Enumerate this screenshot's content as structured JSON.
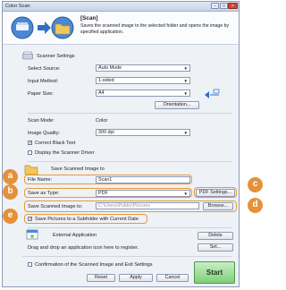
{
  "window": {
    "title": "Color Scan",
    "minimize_glyph": "−",
    "maximize_glyph": "□",
    "close_glyph": "×"
  },
  "header": {
    "title": "[Scan]",
    "description": "Saves the scanned image to the selected folder and opens the image by specified application."
  },
  "scanner_settings": {
    "heading": "Scanner Settings",
    "select_source": {
      "label": "Select Source:",
      "value": "Auto Mode"
    },
    "input_method": {
      "label": "Input Method:",
      "value": "1-sided"
    },
    "paper_size": {
      "label": "Paper Size:",
      "value": "A4"
    },
    "orientation_button": "Orientation...",
    "scan_mode": {
      "label": "Scan Mode:",
      "value": "Color"
    },
    "image_quality": {
      "label": "Image Quality:",
      "value": "300 dpi"
    },
    "correct_black_text": {
      "label": "Correct Black Text",
      "checked": true
    },
    "display_scanner_driver": {
      "label": "Display the Scanner Driver",
      "checked": false
    }
  },
  "save_settings": {
    "heading": "Save Scanned Image to",
    "file_name": {
      "label": "File Name:",
      "value": "Scan1"
    },
    "save_as_type": {
      "label": "Save as Type:",
      "value": "PDF"
    },
    "pdf_settings_button": "PDF Settings...",
    "save_to": {
      "label": "Save Scanned Image to:",
      "value": "C:\\Users\\Public\\Pictures"
    },
    "browse_button": "Browse...",
    "subfolder": {
      "label": "Save Pictures to a Subfolder with Current Date",
      "checked": true
    }
  },
  "external_application": {
    "heading": "External Application",
    "hint": "Drag and drop an application icon here to register.",
    "delete_button": "Delete",
    "set_button": "Set..."
  },
  "footer": {
    "confirmation": {
      "label": "Confirmation of the Scanned Image and Exit Settings",
      "checked": false
    },
    "reset_button": "Reset",
    "apply_button": "Apply",
    "cancel_button": "Cancel",
    "start_button": "Start"
  },
  "callouts": {
    "a": "a",
    "b": "b",
    "c": "c",
    "d": "d",
    "e": "e"
  },
  "colors": {
    "callout": "#e5913a",
    "start": "#7fcf78",
    "accent": "#2f6fc6"
  }
}
